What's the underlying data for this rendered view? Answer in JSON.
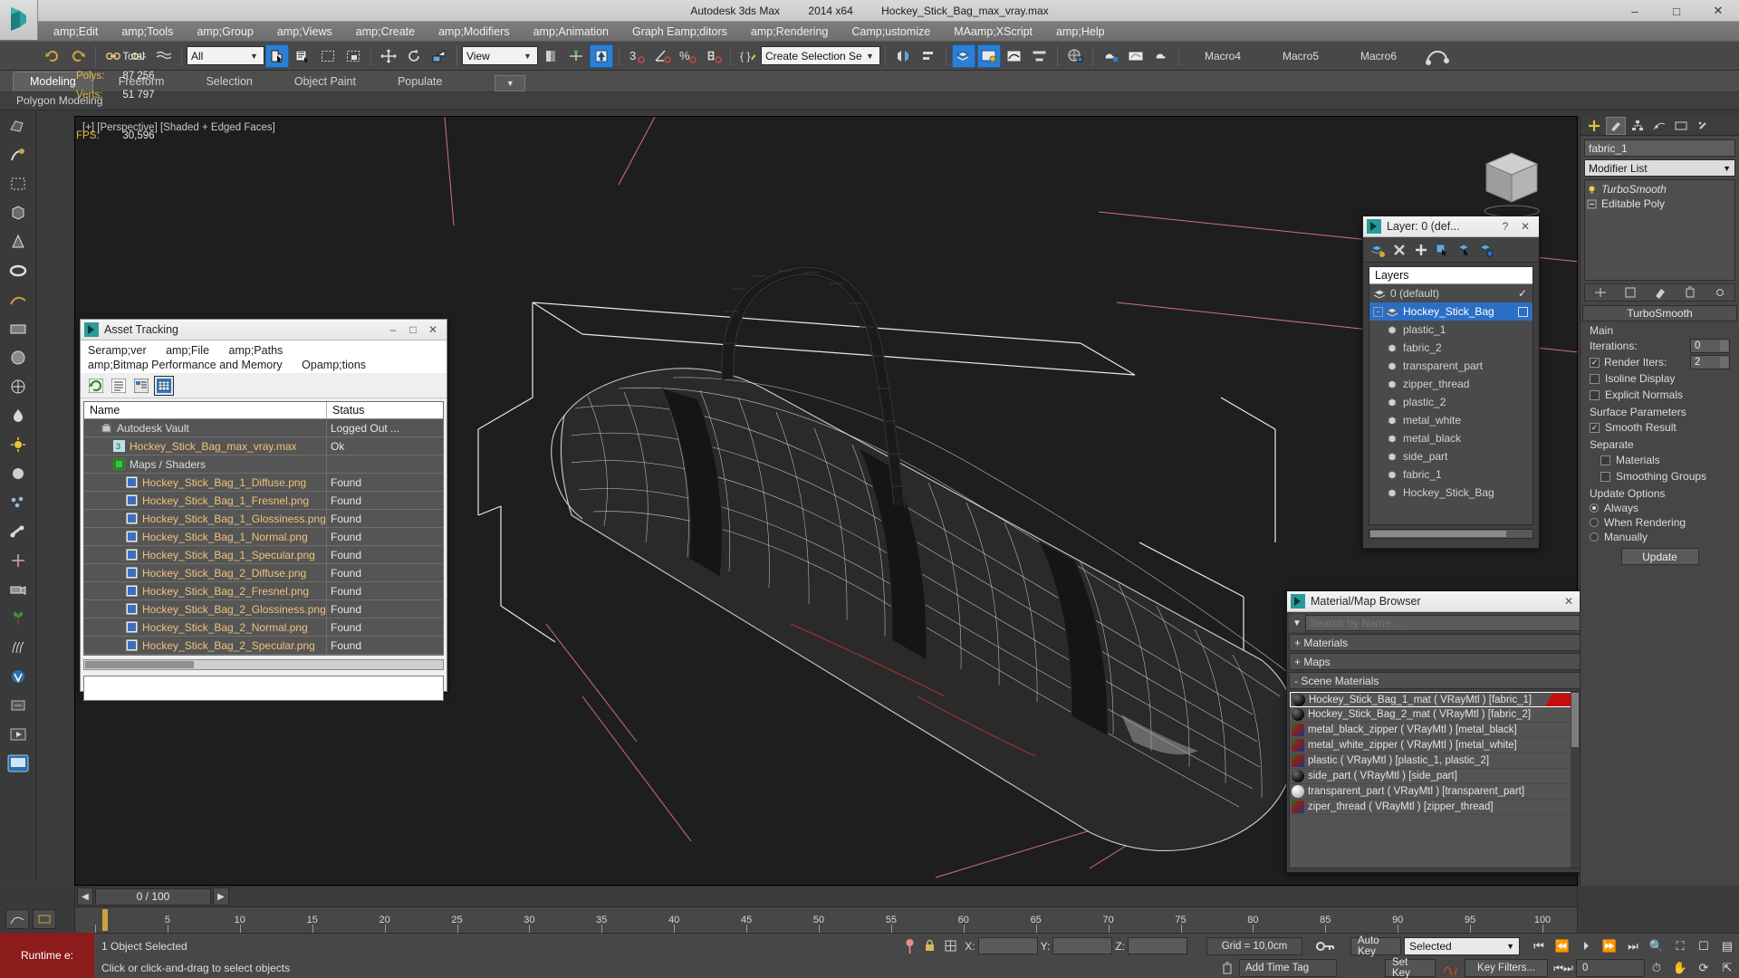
{
  "window": {
    "app_title": "Autodesk 3ds Max",
    "version": "2014 x64",
    "file_name": "Hockey_Stick_Bag_max_vray.max",
    "minimize": "–",
    "maximize": "□",
    "close": "✕"
  },
  "menu": {
    "items": [
      "amp;Edit",
      "amp;Tools",
      "amp;Group",
      "amp;Views",
      "amp;Create",
      "amp;Modifiers",
      "amp;Animation",
      "Graph Eamp;ditors",
      "amp;Rendering",
      "Camp;ustomize",
      "MAamp;XScript",
      "amp;Help"
    ]
  },
  "toolbar": {
    "selection_filter": "All",
    "ref_coord_system": "View",
    "named_selection_sets": "Create Selection Se",
    "snap_value": "3",
    "macro_buttons": [
      "Macro4",
      "Macro5",
      "Macro6"
    ]
  },
  "ribbon": {
    "tabs": [
      "Modeling",
      "Freeform",
      "Selection",
      "Object Paint",
      "Populate"
    ],
    "active_tab": "Modeling",
    "subtitle": "Polygon Modeling"
  },
  "viewport": {
    "label": "[+] [Perspective] [Shaded + Edged Faces]",
    "stats_header": "Total",
    "stats": [
      {
        "name": "Polys:",
        "value": "87 256"
      },
      {
        "name": "Verts:",
        "value": "51 797"
      },
      {
        "name": "FPS:",
        "value": "30,596"
      }
    ]
  },
  "asset_tracking": {
    "title": "Asset Tracking",
    "minimize": "–",
    "maximize": "□",
    "close": "✕",
    "menus_row1": [
      "Seramp;ver",
      "amp;File",
      "amp;Paths"
    ],
    "menus_row2": [
      "amp;Bitmap Performance and Memory",
      "Opamp;tions"
    ],
    "columns": [
      "Name",
      "Status"
    ],
    "rows": [
      {
        "name": "Autodesk Vault",
        "status": "Logged Out ...",
        "indent": 1,
        "icon": "vault-icon",
        "kind": "group"
      },
      {
        "name": "Hockey_Stick_Bag_max_vray.max",
        "status": "Ok",
        "indent": 2,
        "icon": "max-file-icon",
        "kind": "file"
      },
      {
        "name": "Maps / Shaders",
        "status": "",
        "indent": 2,
        "icon": "maps-icon",
        "kind": "group"
      },
      {
        "name": "Hockey_Stick_Bag_1_Diffuse.png",
        "status": "Found",
        "indent": 3,
        "icon": "image-icon",
        "kind": "file"
      },
      {
        "name": "Hockey_Stick_Bag_1_Fresnel.png",
        "status": "Found",
        "indent": 3,
        "icon": "image-icon",
        "kind": "file"
      },
      {
        "name": "Hockey_Stick_Bag_1_Glossiness.png",
        "status": "Found",
        "indent": 3,
        "icon": "image-icon",
        "kind": "file"
      },
      {
        "name": "Hockey_Stick_Bag_1_Normal.png",
        "status": "Found",
        "indent": 3,
        "icon": "image-icon",
        "kind": "file"
      },
      {
        "name": "Hockey_Stick_Bag_1_Specular.png",
        "status": "Found",
        "indent": 3,
        "icon": "image-icon",
        "kind": "file"
      },
      {
        "name": "Hockey_Stick_Bag_2_Diffuse.png",
        "status": "Found",
        "indent": 3,
        "icon": "image-icon",
        "kind": "file"
      },
      {
        "name": "Hockey_Stick_Bag_2_Fresnel.png",
        "status": "Found",
        "indent": 3,
        "icon": "image-icon",
        "kind": "file"
      },
      {
        "name": "Hockey_Stick_Bag_2_Glossiness.png",
        "status": "Found",
        "indent": 3,
        "icon": "image-icon",
        "kind": "file"
      },
      {
        "name": "Hockey_Stick_Bag_2_Normal.png",
        "status": "Found",
        "indent": 3,
        "icon": "image-icon",
        "kind": "file"
      },
      {
        "name": "Hockey_Stick_Bag_2_Specular.png",
        "status": "Found",
        "indent": 3,
        "icon": "image-icon",
        "kind": "file"
      }
    ]
  },
  "layer_panel": {
    "title": "Layer: 0 (def...",
    "help": "?",
    "close": "✕",
    "list_header": "Layers",
    "rows": [
      {
        "label": "0 (default)",
        "indent": 1,
        "selected": false,
        "check": "✓"
      },
      {
        "label": "Hockey_Stick_Bag",
        "indent": 1,
        "selected": true,
        "expander": "-"
      },
      {
        "label": "plastic_1",
        "indent": 2,
        "selected": false
      },
      {
        "label": "fabric_2",
        "indent": 2,
        "selected": false
      },
      {
        "label": "transparent_part",
        "indent": 2,
        "selected": false
      },
      {
        "label": "zipper_thread",
        "indent": 2,
        "selected": false
      },
      {
        "label": "plastic_2",
        "indent": 2,
        "selected": false
      },
      {
        "label": "metal_white",
        "indent": 2,
        "selected": false
      },
      {
        "label": "metal_black",
        "indent": 2,
        "selected": false
      },
      {
        "label": "side_part",
        "indent": 2,
        "selected": false
      },
      {
        "label": "fabric_1",
        "indent": 2,
        "selected": false
      },
      {
        "label": "Hockey_Stick_Bag",
        "indent": 2,
        "selected": false
      }
    ]
  },
  "material_browser": {
    "title": "Material/Map Browser",
    "close": "✕",
    "search_placeholder": "Search by Name ...",
    "sections": [
      {
        "label": "+ Materials"
      },
      {
        "label": "+ Maps"
      },
      {
        "label": "- Scene Materials"
      }
    ],
    "materials": [
      {
        "label": "Hockey_Stick_Bag_1_mat  ( VRayMtl )  [fabric_1]",
        "selected": true,
        "swatch": "sphere",
        "tag_color": "#c40d0d"
      },
      {
        "label": "Hockey_Stick_Bag_2_mat  ( VRayMtl )  [fabric_2]",
        "selected": false,
        "swatch": "sphere"
      },
      {
        "label": "metal_black_zipper  ( VRayMtl )  [metal_black]",
        "selected": false,
        "swatch": "checker"
      },
      {
        "label": "metal_white_zipper  ( VRayMtl )  [metal_white]",
        "selected": false,
        "swatch": "checker"
      },
      {
        "label": "plastic  ( VRayMtl )  [plastic_1, plastic_2]",
        "selected": false,
        "swatch": "checker"
      },
      {
        "label": "side_part  ( VRayMtl )  [side_part]",
        "selected": false,
        "swatch": "sphere"
      },
      {
        "label": "transparent_part  ( VRayMtl )  [transparent_part]",
        "selected": false,
        "swatch": "glass"
      },
      {
        "label": "ziper_thread  ( VRayMtl )  [zipper_thread]",
        "selected": false,
        "swatch": "checker"
      }
    ]
  },
  "command_panel": {
    "object_name": "fabric_1",
    "modifier_list_label": "Modifier List",
    "stack": [
      {
        "label": "TurboSmooth",
        "italic": true
      },
      {
        "label": "Editable Poly",
        "italic": false
      }
    ],
    "rollout_title": "TurboSmooth",
    "main_label": "Main",
    "iterations_label": "Iterations:",
    "iterations_value": "0",
    "render_iters_label": "Render Iters:",
    "render_iters_value": "2",
    "render_iters_checked": true,
    "isoline_display": {
      "label": "Isoline Display",
      "checked": false
    },
    "explicit_normals": {
      "label": "Explicit Normals",
      "checked": false
    },
    "surface_params_label": "Surface Parameters",
    "smooth_result": {
      "label": "Smooth Result",
      "checked": true
    },
    "separate_label": "Separate",
    "materials_chk": {
      "label": "Materials",
      "checked": false
    },
    "smoothing_groups_chk": {
      "label": "Smoothing Groups",
      "checked": false
    },
    "update_options_label": "Update Options",
    "update_radios": [
      {
        "label": "Always",
        "selected": true
      },
      {
        "label": "When Rendering",
        "selected": false
      },
      {
        "label": "Manually",
        "selected": false
      }
    ],
    "update_button": "Update"
  },
  "timeline": {
    "prev": "◀",
    "next": "▶",
    "frame_display": "0 / 100",
    "ruler_labels": [
      "5",
      "10",
      "15",
      "20",
      "25",
      "30",
      "35",
      "40",
      "45",
      "50",
      "55",
      "60",
      "65",
      "70",
      "75",
      "80",
      "85",
      "90",
      "95",
      "100"
    ]
  },
  "status_bar": {
    "selection_info": "1 Object Selected",
    "prompt": "Click or click-and-drag to select objects",
    "x_label": "X:",
    "y_label": "Y:",
    "z_label": "Z:",
    "x_value": "",
    "y_value": "",
    "z_value": "",
    "grid_label": "Grid = 10,0cm",
    "add_time_tag": "Add Time Tag",
    "auto_key": "Auto Key",
    "set_key": "Set Key",
    "key_mode": "Selected",
    "key_filters": "Key Filters...",
    "current_frame": "0",
    "runtime": "Runtime e:"
  }
}
